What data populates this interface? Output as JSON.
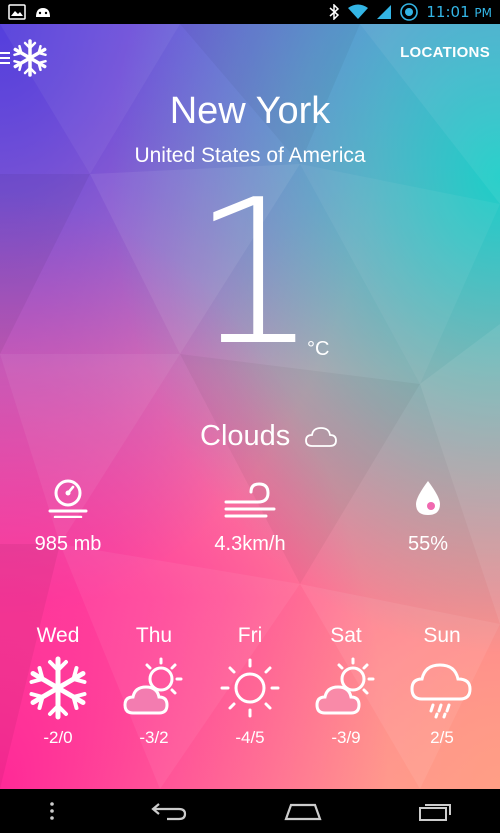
{
  "status_bar": {
    "time": "11:01",
    "ampm": "PM"
  },
  "header": {
    "locations_label": "LOCATIONS"
  },
  "location": {
    "city": "New York",
    "country": "United States of America"
  },
  "current": {
    "temperature": "1",
    "unit": "°C",
    "condition": "Clouds",
    "condition_icon": "cloud-icon"
  },
  "stats": {
    "pressure": {
      "value": "985 mb",
      "icon": "pressure-gauge-icon"
    },
    "wind": {
      "value": "4.3km/h",
      "icon": "wind-icon"
    },
    "humidity": {
      "value": "55%",
      "icon": "water-drop-icon"
    }
  },
  "forecast": [
    {
      "day": "Wed",
      "range": "-2/0",
      "icon": "snowflake-icon"
    },
    {
      "day": "Thu",
      "range": "-3/2",
      "icon": "partly-cloudy-icon"
    },
    {
      "day": "Fri",
      "range": "-4/5",
      "icon": "sun-icon"
    },
    {
      "day": "Sat",
      "range": "-3/9",
      "icon": "partly-cloudy-icon"
    },
    {
      "day": "Sun",
      "range": "2/5",
      "icon": "rain-cloud-icon"
    }
  ],
  "colors": {
    "status_accent": "#33b5e5",
    "text": "#ffffff"
  }
}
